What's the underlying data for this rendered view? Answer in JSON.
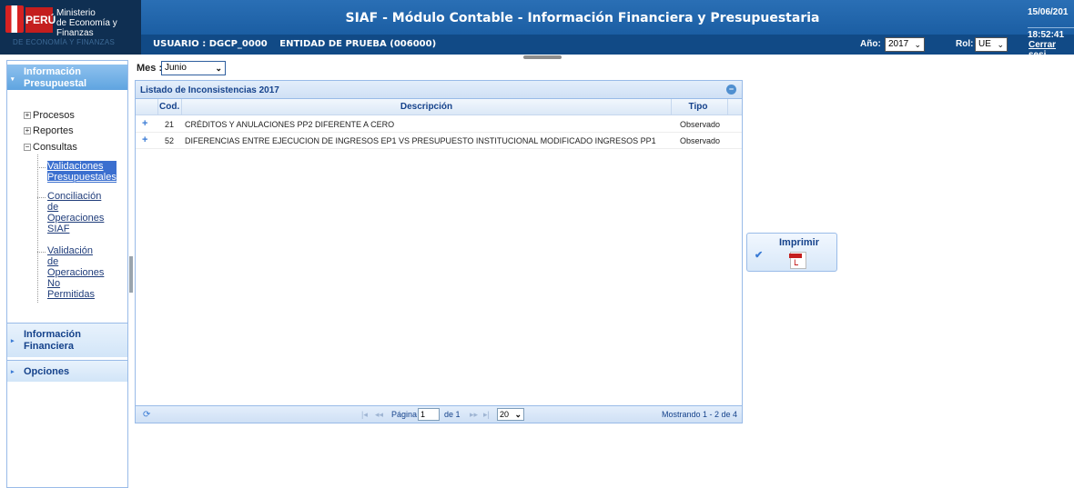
{
  "header": {
    "logo": {
      "country": "PERÚ",
      "ministry_line1": "Ministerio",
      "ministry_line2": "de Economía y Finanzas",
      "tagline": "DE ECONOMÍA Y FINANZAS"
    },
    "title": "SIAF - Módulo Contable - Información Financiera y Presupuestaria",
    "date": "15/06/201",
    "time": "18:52:41",
    "user_label": "USUARIO : DGCP_0000",
    "entity_label": "ENTIDAD DE PRUEBA (006000)",
    "year_label": "Año:",
    "year_value": "2017",
    "role_label": "Rol:",
    "role_value": "UE",
    "logout_label": "Cerrar sesi"
  },
  "sidebar": {
    "sections": [
      {
        "label_line1": "Información",
        "label_line2": "Presupuestal",
        "expanded": true
      },
      {
        "label_line1": "Información",
        "label_line2": "Financiera",
        "expanded": false
      },
      {
        "label_line1": "Opciones",
        "expanded": false
      }
    ],
    "tree": {
      "procesos": "Procesos",
      "reportes": "Reportes",
      "consultas": "Consultas",
      "leaves": [
        {
          "lines": [
            "Validaciones",
            "Presupuestales"
          ],
          "selected": true
        },
        {
          "lines": [
            "Conciliación",
            "de",
            "Operaciones",
            "SIAF"
          ],
          "selected": false
        },
        {
          "lines": [
            "Validación",
            "de",
            "Operaciones",
            "No",
            "Permitidas"
          ],
          "selected": false
        }
      ]
    }
  },
  "filters": {
    "month_label": "Mes :",
    "month_value": "Junio"
  },
  "panel": {
    "title": "Listado de Inconsistencias 2017",
    "columns": {
      "code": "Cod.",
      "description": "Descripción",
      "type": "Tipo"
    },
    "rows": [
      {
        "code": "21",
        "description": "CRÉDITOS Y ANULACIONES PP2 DIFERENTE A CERO",
        "type": "Observado"
      },
      {
        "code": "52",
        "description": "DIFERENCIAS ENTRE EJECUCION DE INGRESOS EP1 VS PRESUPUESTO INSTITUCIONAL MODIFICADO INGRESOS PP1",
        "type": "Observado"
      }
    ],
    "pager": {
      "page_label": "Página",
      "page_value": "1",
      "of_label": "de 1",
      "page_size": "20",
      "summary": "Mostrando 1 - 2 de 4"
    }
  },
  "print": {
    "label": "Imprimir",
    "pdf_label": "PDF"
  },
  "colors": {
    "header": "#1b5ea3",
    "header_dark": "#114a86",
    "accent": "#15428b",
    "active_section": "#5fa4e0",
    "selected_leaf": "#3b6fcf"
  },
  "icons": [
    "expand-tree-icon",
    "collapse-tree-icon",
    "expand-row-icon",
    "refresh-icon",
    "first-page-icon",
    "prev-page-icon",
    "next-page-icon",
    "last-page-icon",
    "checkmark-icon",
    "pdf-icon",
    "collapse-panel-icon",
    "caret-icon",
    "dropdown-arrow-icon"
  ]
}
